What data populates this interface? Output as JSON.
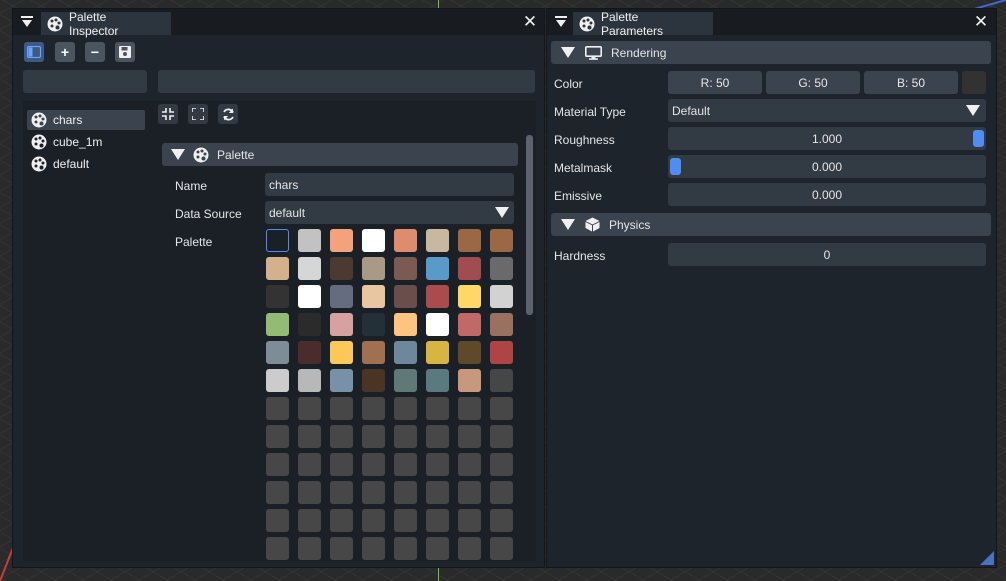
{
  "inspector": {
    "title": "Palette Inspector",
    "close_glyph": "✕",
    "toolbar_icons": [
      "sidebar-toggle-icon",
      "plus-icon",
      "minus-icon",
      "save-icon"
    ],
    "add_glyph": "+",
    "remove_glyph": "−",
    "search_left_value": "",
    "search_right_value": "",
    "palettes": [
      "chars",
      "cube_1m",
      "default"
    ],
    "selected_palette": "chars",
    "section_title": "Palette",
    "name_label": "Name",
    "name_value": "chars",
    "data_source_label": "Data Source",
    "data_source_value": "default",
    "palette_label": "Palette",
    "swatches": [
      [
        "#1b2027",
        "#c2c2c2",
        "#f5a27c",
        "#ffffff",
        "#df8b6d",
        "#c8b8a0",
        "#9c6843",
        "#9c6843"
      ],
      [
        "#d5b08c",
        "#d6d6d6",
        "#4c3a32",
        "#a89a86",
        "#7a5a52",
        "#5a9ac8",
        "#a04c50",
        "#6a6a6a"
      ],
      [
        "#333333",
        "#ffffff",
        "#656c80",
        "#e8c6a0",
        "#6a4e4c",
        "#aa4c4e",
        "#fed767",
        "#d2d2d2"
      ],
      [
        "#94bb73",
        "#2b2b2b",
        "#d8a0a0",
        "#243038",
        "#fec37f",
        "#ffffff",
        "#c16868",
        "#9a7060"
      ],
      [
        "#7d8c96",
        "#4a2c2c",
        "#fec858",
        "#a07050",
        "#6c889a",
        "#d8b440",
        "#60482a",
        "#b04444"
      ],
      [
        "#cccccc",
        "#b8b8b8",
        "#7890a8",
        "#4c3424",
        "#607878",
        "#5a7a80",
        "#c8987c",
        "#464646"
      ],
      [
        "#474747",
        "#474747",
        "#474747",
        "#474747",
        "#474747",
        "#474747",
        "#474747",
        "#474747"
      ],
      [
        "#474747",
        "#474747",
        "#474747",
        "#474747",
        "#474747",
        "#474747",
        "#474747",
        "#474747"
      ],
      [
        "#474747",
        "#474747",
        "#474747",
        "#474747",
        "#474747",
        "#474747",
        "#474747",
        "#474747"
      ],
      [
        "#474747",
        "#474747",
        "#474747",
        "#474747",
        "#474747",
        "#474747",
        "#474747",
        "#474747"
      ],
      [
        "#474747",
        "#474747",
        "#474747",
        "#474747",
        "#474747",
        "#474747",
        "#474747",
        "#474747"
      ],
      [
        "#474747",
        "#474747",
        "#474747",
        "#474747",
        "#474747",
        "#474747",
        "#474747",
        "#474747"
      ]
    ],
    "selected_swatch": [
      0,
      0
    ],
    "selection_color": "#4f8df2"
  },
  "parameters": {
    "title": "Palette Parameters",
    "close_glyph": "✕",
    "rendering_title": "Rendering",
    "color_label": "Color",
    "r_label": "R: 50",
    "g_label": "G: 50",
    "b_label": "B: 50",
    "color_preview": "#323232",
    "material_type_label": "Material Type",
    "material_type_value": "Default",
    "roughness_label": "Roughness",
    "roughness_value": "1.000",
    "roughness_level": 1.0,
    "metalmask_label": "Metalmask",
    "metalmask_value": "0.000",
    "metalmask_level": 0.0,
    "emissive_label": "Emissive",
    "emissive_value": "0.000",
    "physics_title": "Physics",
    "hardness_label": "Hardness",
    "hardness_value": "0"
  },
  "colors": {
    "accent": "#4f8df2",
    "panel_bg": "#1e242b",
    "field_bg": "#323a44",
    "header_bg": "#3a434e"
  }
}
